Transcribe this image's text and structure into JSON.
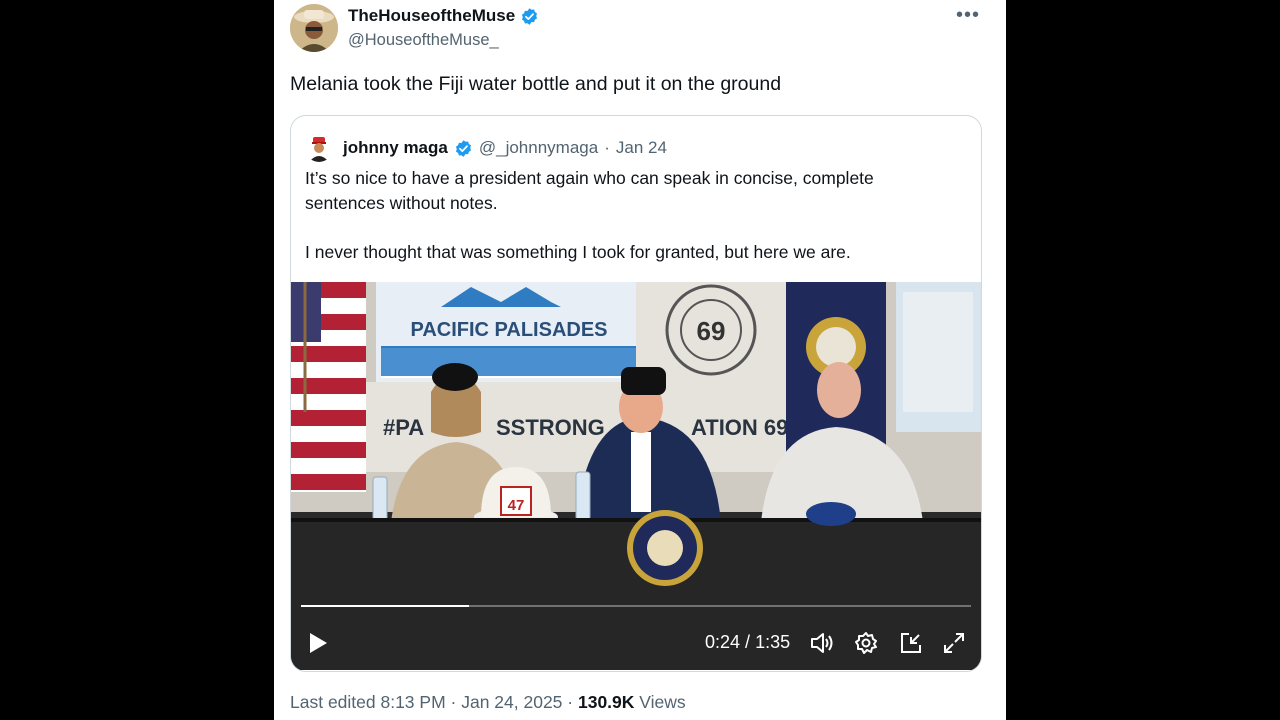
{
  "post": {
    "author_name": "TheHouseoftheMuse",
    "author_handle": "@HouseoftheMuse_",
    "text": "Melania took the Fiji water bottle and put it on the ground",
    "more_icon": "more-dots-icon"
  },
  "quote": {
    "author_name": "johnny maga",
    "author_handle": "@_johnnymaga",
    "separator": "·",
    "date": "Jan 24",
    "paragraph1": "It’s so nice to have a president again who can speak in concise, complete sentences without notes.",
    "paragraph2": "I never thought that was something I took for granted, but here we are."
  },
  "video": {
    "banner_text": "PACIFIC PALISADES",
    "hashtag_left": "#PA",
    "hashtag_mid": "SSTRONG",
    "hashtag_right": "ATION 69",
    "badge_number": "69",
    "helmet_number": "47",
    "current_time": "0:24",
    "duration": "1:35",
    "time_separator": " / ",
    "progress": 0.25
  },
  "footer": {
    "edited": "Last edited 8:13 PM",
    "separator": " · ",
    "date": "Jan 24, 2025",
    "views_count": "130.9K",
    "views_label": " Views"
  },
  "colors": {
    "verified": "#1d9bf0",
    "text": "#0f1419",
    "muted": "#536471",
    "border": "#cfd9de"
  }
}
